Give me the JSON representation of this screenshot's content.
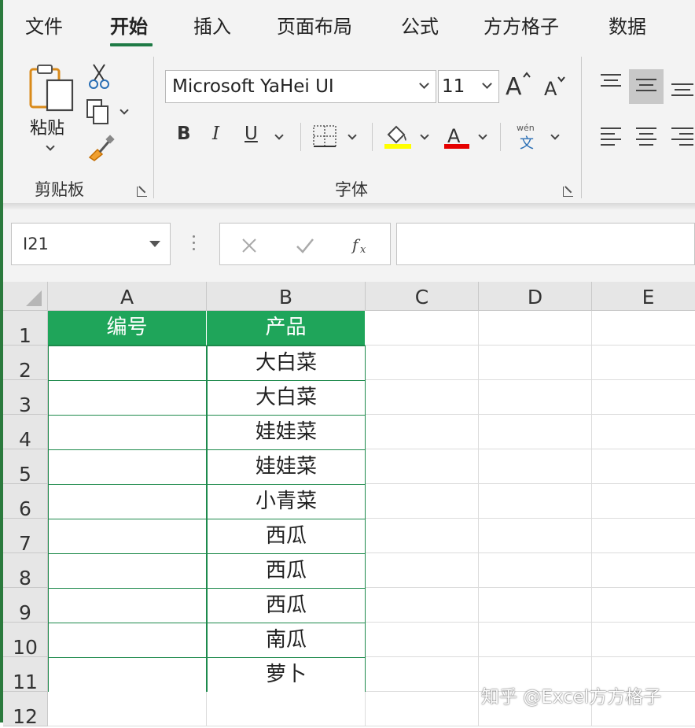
{
  "tabs": [
    {
      "label": "文件",
      "active": false
    },
    {
      "label": "开始",
      "active": true
    },
    {
      "label": "插入",
      "active": false
    },
    {
      "label": "页面布局",
      "active": false
    },
    {
      "label": "公式",
      "active": false
    },
    {
      "label": "方方格子",
      "active": false
    },
    {
      "label": "数据",
      "active": false
    }
  ],
  "ribbon": {
    "clipboard": {
      "paste_label": "粘贴",
      "group_label": "剪贴板"
    },
    "font": {
      "font_name": "Microsoft YaHei UI",
      "font_size": "11",
      "bold_label": "B",
      "italic_label": "I",
      "underline_label": "U",
      "font_color_label": "A",
      "fill_color": "#ffff00",
      "font_color": "#e60000",
      "phonetic_top": "wén",
      "phonetic_bottom": "文",
      "group_label": "字体"
    }
  },
  "formula_bar": {
    "name_box": "I21",
    "cancel_icon": "x-icon",
    "enter_icon": "check-icon",
    "fx_label": "fx",
    "formula": ""
  },
  "sheet": {
    "columns": [
      "A",
      "B",
      "C",
      "D",
      "E"
    ],
    "rows": [
      "1",
      "2",
      "3",
      "4",
      "5",
      "6",
      "7",
      "8",
      "9",
      "10",
      "11",
      "12"
    ],
    "header_row": {
      "A": "编号",
      "B": "产品"
    },
    "products": [
      "大白菜",
      "大白菜",
      "娃娃菜",
      "娃娃菜",
      "小青菜",
      "西瓜",
      "西瓜",
      "西瓜",
      "南瓜",
      "萝卜"
    ],
    "header_fill": "#1fa55a",
    "border_color": "#1e8a4c"
  },
  "watermark": "知乎 @Excel方方格子"
}
